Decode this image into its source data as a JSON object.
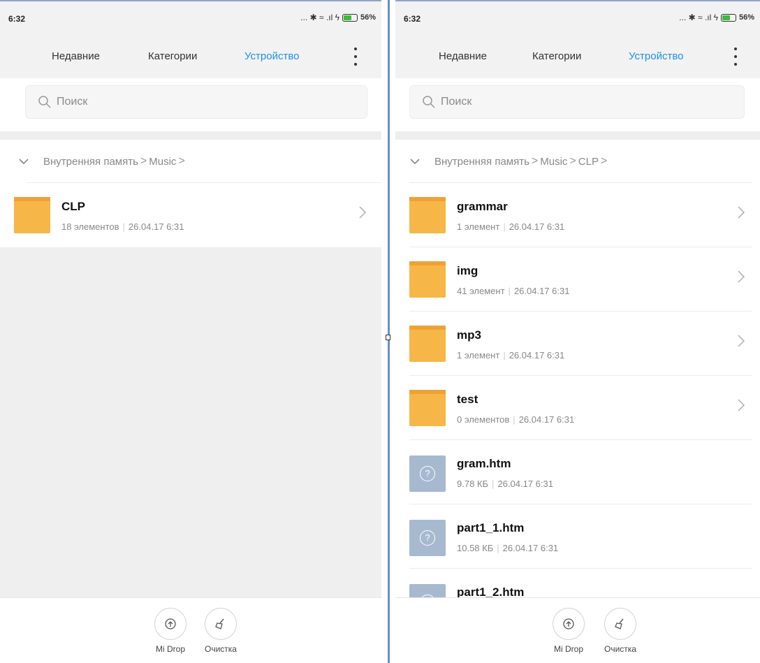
{
  "screens": [
    {
      "status": {
        "time": "6:32",
        "battery": "56%",
        "battery_level": 0.56,
        "icons": "... ✱ ≈ .ıl ϟ"
      },
      "tabs": {
        "recent": "Недавние",
        "categories": "Категории",
        "device": "Устройство",
        "active": "device"
      },
      "search": {
        "placeholder": "Поиск"
      },
      "breadcrumb": {
        "root": "Внутренняя память",
        "path": [
          "Music"
        ]
      },
      "items": [
        {
          "kind": "folder",
          "name": "CLP",
          "count": "18 элементов",
          "date": "26.04.17 6:31"
        }
      ],
      "bottom": {
        "midrop": "Mi Drop",
        "cleanup": "Очистка"
      }
    },
    {
      "status": {
        "time": "6:32",
        "battery": "56%",
        "battery_level": 0.56,
        "icons": "... ✱ ≈ .ıl ϟ"
      },
      "tabs": {
        "recent": "Недавние",
        "categories": "Категории",
        "device": "Устройство",
        "active": "device"
      },
      "search": {
        "placeholder": "Поиск"
      },
      "breadcrumb": {
        "root": "Внутренняя память",
        "path": [
          "Music",
          "CLP"
        ]
      },
      "items": [
        {
          "kind": "folder",
          "name": "grammar",
          "count": "1 элемент",
          "date": "26.04.17 6:31"
        },
        {
          "kind": "folder",
          "name": "img",
          "count": "41 элемент",
          "date": "26.04.17 6:31"
        },
        {
          "kind": "folder",
          "name": "mp3",
          "count": "1 элемент",
          "date": "26.04.17 6:31"
        },
        {
          "kind": "folder",
          "name": "test",
          "count": "0 элементов",
          "date": "26.04.17 6:31"
        },
        {
          "kind": "file",
          "name": "gram.htm",
          "count": "9.78 КБ",
          "date": "26.04.17 6:31"
        },
        {
          "kind": "file",
          "name": "part1_1.htm",
          "count": "10.58 КБ",
          "date": "26.04.17 6:31"
        },
        {
          "kind": "file",
          "name": "part1_2.htm",
          "count": "",
          "date": ""
        }
      ],
      "bottom": {
        "midrop": "Mi Drop",
        "cleanup": "Очистка"
      }
    }
  ],
  "colors": {
    "accent": "#1e8ff0",
    "folder": "#f7b648",
    "file_icon": "#a7b9cf",
    "separator": "#6b8fc7"
  }
}
